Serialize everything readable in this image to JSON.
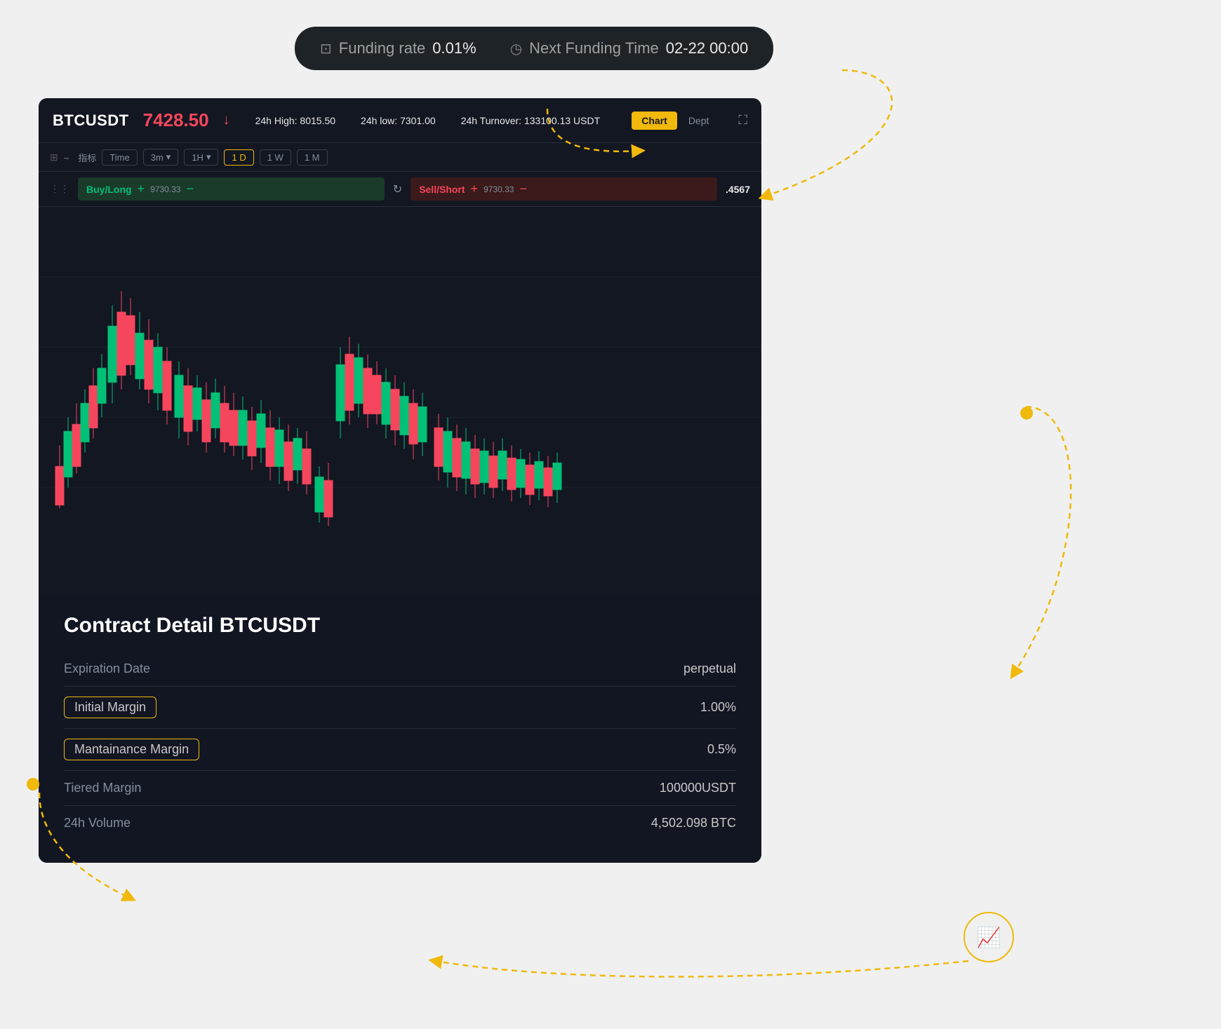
{
  "funding": {
    "rate_label": "Funding rate",
    "rate_value": "0.01%",
    "rate_icon": "percent-icon",
    "next_label": "Next Funding Time",
    "next_value": "02-22 00:00",
    "clock_icon": "clock-icon"
  },
  "header": {
    "symbol": "BTCUSDT",
    "price": "7428.50",
    "price_direction": "down",
    "high_label": "24h High:",
    "high_value": "8015.50",
    "low_label": "24h low:",
    "low_value": "7301.00",
    "turnover_label": "24h Turnover:",
    "turnover_value": "133100.13 USDT",
    "tab_chart": "Chart",
    "tab_depth": "Dept",
    "fullscreen_icon": "fullscreen-icon"
  },
  "toolbar": {
    "indicator_label": "指标",
    "time_btn": "Time",
    "intervals": [
      "3m",
      "1H",
      "1D",
      "1W",
      "1M"
    ],
    "active_interval": "1D"
  },
  "order_panel": {
    "buy_label": "Buy/Long",
    "buy_price": "9730.33",
    "sell_label": "Sell/Short",
    "sell_price": "9730.33",
    "sell_value": ".4567"
  },
  "contract": {
    "title": "Contract Detail BTCUSDT",
    "rows": [
      {
        "label": "Expiration Date",
        "value": "perpetual",
        "highlighted": false
      },
      {
        "label": "Initial Margin",
        "value": "1.00%",
        "highlighted": true
      },
      {
        "label": "Mantainance Margin",
        "value": "0.5%",
        "highlighted": true
      },
      {
        "label": "Tiered Margin",
        "value": "100000USDT",
        "highlighted": false
      },
      {
        "label": "24h Volume",
        "value": "4,502.098 BTC",
        "highlighted": false
      }
    ]
  },
  "colors": {
    "accent": "#f0b90b",
    "up": "#02c076",
    "down": "#f6465d",
    "bg": "#131722",
    "text_primary": "#ffffff",
    "text_secondary": "#848e9c"
  }
}
